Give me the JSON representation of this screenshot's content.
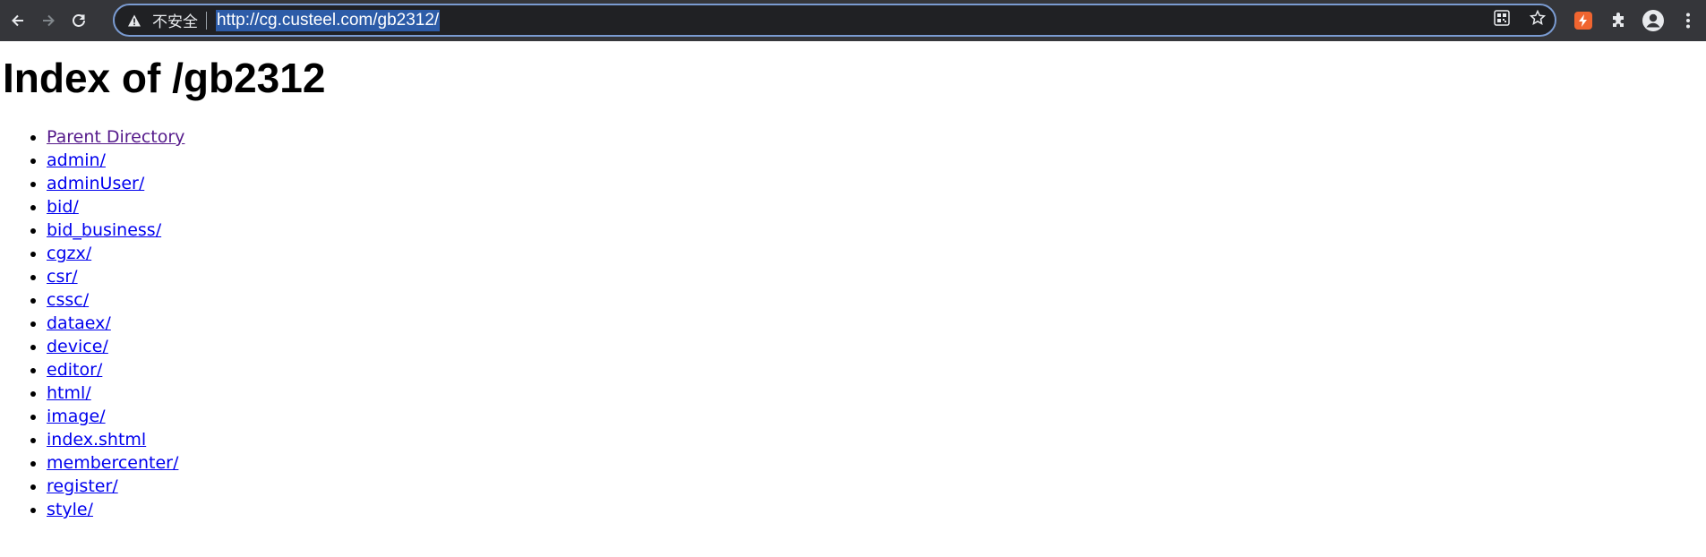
{
  "browser": {
    "security_label": "不安全",
    "url": "http://cg.custeel.com/gb2312/",
    "colors": {
      "toolbar": "#35363a",
      "omnibox": "#202124",
      "url_highlight": "#2d5ca8",
      "extension": "#f06530"
    },
    "icons": [
      "back-icon",
      "forward-icon",
      "reload-icon",
      "warning-icon",
      "qr-code-icon",
      "bookmark-star-icon",
      "extension-icon",
      "puzzle-icon",
      "profile-icon",
      "menu-icon"
    ]
  },
  "page": {
    "title": "Index of /gb2312",
    "links": [
      {
        "label": "Parent Directory",
        "visited": true
      },
      {
        "label": "admin/"
      },
      {
        "label": "adminUser/"
      },
      {
        "label": "bid/"
      },
      {
        "label": "bid_business/"
      },
      {
        "label": "cgzx/"
      },
      {
        "label": "csr/"
      },
      {
        "label": "cssc/"
      },
      {
        "label": "dataex/"
      },
      {
        "label": "device/"
      },
      {
        "label": "editor/"
      },
      {
        "label": "html/"
      },
      {
        "label": "image/"
      },
      {
        "label": "index.shtml"
      },
      {
        "label": "membercenter/"
      },
      {
        "label": "register/"
      },
      {
        "label": "style/"
      }
    ],
    "colors": {
      "link": "#0000ee",
      "visited_link": "#551a8b"
    }
  }
}
